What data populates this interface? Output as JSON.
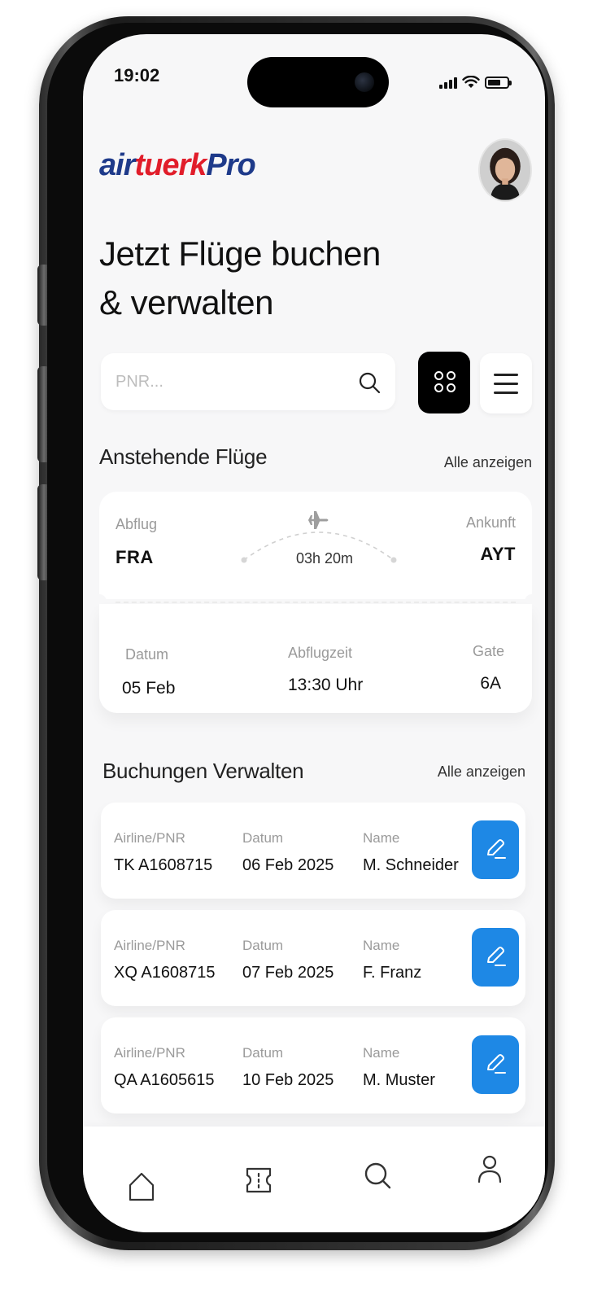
{
  "status_bar": {
    "time": "19:02"
  },
  "brand": {
    "part1": "air",
    "part2": "tuerk",
    "part3": "Pro"
  },
  "header": {
    "title_line1": "Jetzt Flüge buchen",
    "title_line2": "& verwalten"
  },
  "search": {
    "placeholder": "PNR..."
  },
  "upcoming": {
    "title": "Anstehende Flüge",
    "see_all": "Alle anzeigen",
    "flight": {
      "departure_label": "Abflug",
      "departure_code": "FRA",
      "arrival_label": "Ankunft",
      "arrival_code": "AYT",
      "duration": "03h 20m",
      "date_label": "Datum",
      "date": "05 Feb",
      "time_label": "Abflugzeit",
      "time": "13:30 Uhr",
      "gate_label": "Gate",
      "gate": "6A"
    }
  },
  "bookings": {
    "title": "Buchungen Verwalten",
    "see_all": "Alle anzeigen",
    "col_pnr": "Airline/PNR",
    "col_date": "Datum",
    "col_name": "Name",
    "items": [
      {
        "pnr": "TK A1608715",
        "date": "06 Feb 2025",
        "name": "M. Schneider"
      },
      {
        "pnr": "XQ A1608715",
        "date": "07 Feb 2025",
        "name": "F. Franz"
      },
      {
        "pnr": "QA A1605615",
        "date": "10 Feb 2025",
        "name": "M. Muster"
      }
    ]
  },
  "colors": {
    "accent": "#1e88e5",
    "brand_blue": "#1e3a8a",
    "brand_red": "#e11d2a"
  },
  "icons": [
    "search-icon",
    "grid-icon",
    "menu-icon",
    "plane-icon",
    "edit-icon",
    "home-icon",
    "ticket-icon",
    "search-tab-icon",
    "profile-icon"
  ]
}
